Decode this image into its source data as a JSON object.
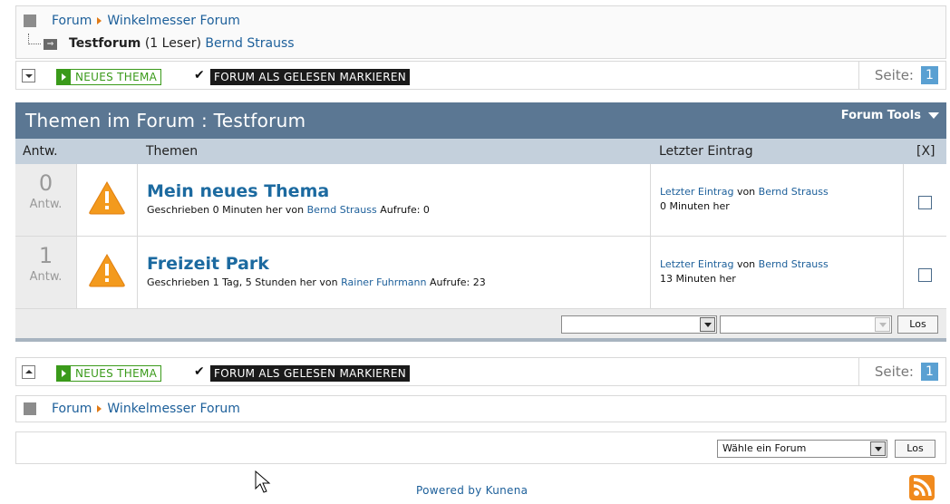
{
  "breadcrumb_top": {
    "items": [
      "Forum",
      "Winkelmesser Forum"
    ],
    "sub_forum": "Testforum",
    "readers": "(1 Leser)",
    "user": "Bernd Strauss"
  },
  "toolbar": {
    "new_topic": "NEUES THEMA",
    "check_mark": "✔",
    "mark_read": "FORUM ALS GELESEN MARKIEREN",
    "page_label": "Seite:",
    "page_number": "1"
  },
  "forum_header": {
    "title": "Themen im Forum : Testforum",
    "tools": "Forum Tools"
  },
  "columns": {
    "replies": "Antw.",
    "topics": "Themen",
    "last_post": "Letzter Eintrag",
    "select": "[X]"
  },
  "topics": [
    {
      "count": "0",
      "count_label": "Antw.",
      "title": "Mein neues Thema",
      "meta_prefix": "Geschrieben 0 Minuten her von",
      "author": "Bernd Strauss",
      "views": "Aufrufe: 0",
      "last_link": "Letzter Eintrag",
      "last_by": "von",
      "last_user": "Bernd Strauss",
      "last_time": "0 Minuten her",
      "icon": "warning-icon"
    },
    {
      "count": "1",
      "count_label": "Antw.",
      "title": "Freizeit Park",
      "meta_prefix": "Geschrieben 1 Tag, 5 Stunden her von",
      "author": "Rainer Fuhrmann",
      "views": "Aufrufe: 23",
      "last_link": "Letzter Eintrag",
      "last_by": "von",
      "last_user": "Bernd Strauss",
      "last_time": "13 Minuten her",
      "icon": "warning-icon"
    }
  ],
  "moderation": {
    "go": "Los"
  },
  "breadcrumb_bottom": {
    "items": [
      "Forum",
      "Winkelmesser Forum"
    ]
  },
  "jump": {
    "select_value": "Wähle ein Forum",
    "go": "Los"
  },
  "footer": {
    "powered": "Powered by Kunena"
  },
  "colors": {
    "header_bg": "#5b7793",
    "column_bg": "#c4d0dc",
    "link": "#1c5f9a",
    "new_topic_green": "#3a9a1a",
    "page_blue": "#5aa0d2",
    "rss_orange": "#f08a1e"
  }
}
